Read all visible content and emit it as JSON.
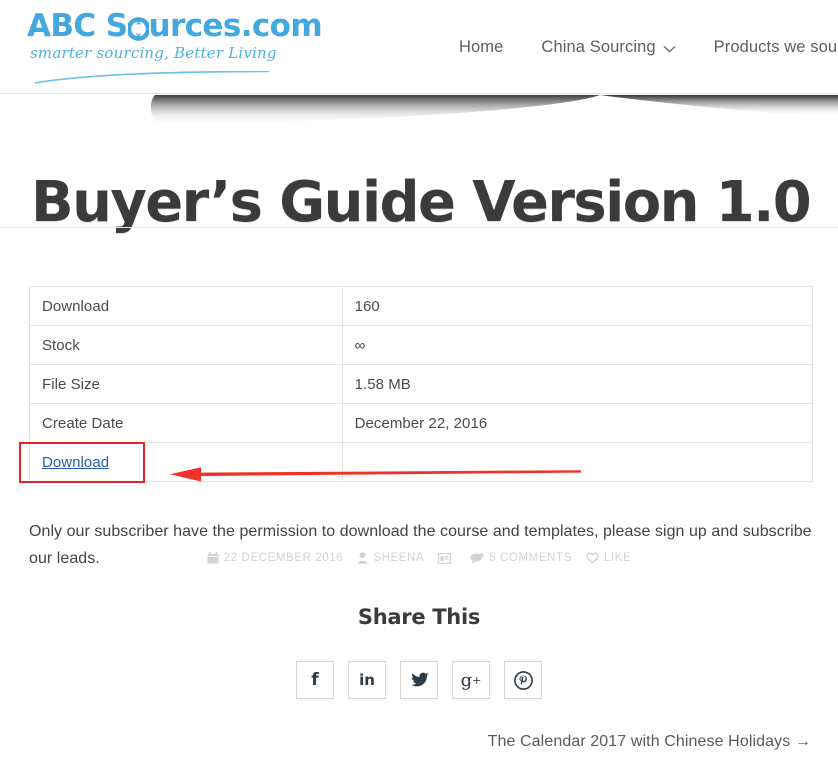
{
  "header": {
    "logo": {
      "wordmark_part1": "ABC S",
      "wordmark_icon": "link-chain-icon",
      "wordmark_part2": "urces.com",
      "tagline": "smarter sourcing, Better Living",
      "brand_color": "#43a8dd"
    },
    "nav": [
      {
        "label": "Home",
        "has_dropdown": false,
        "icon": null
      },
      {
        "label": "China Sourcing",
        "has_dropdown": true,
        "icon": "chevron-down-icon"
      },
      {
        "label": "Products we sourced",
        "has_dropdown": false,
        "icon": null
      }
    ]
  },
  "page": {
    "title": "Buyer’s Guide Version 1.0"
  },
  "details_table": {
    "rows": [
      {
        "label": "Download",
        "value": "160"
      },
      {
        "label": "Stock",
        "value": "∞"
      },
      {
        "label": "File Size",
        "value": "1.58 MB"
      },
      {
        "label": "Create Date",
        "value": "December 22, 2016"
      }
    ],
    "download_link_label": "Download",
    "download_link_color": "#2a5db0"
  },
  "annotation": {
    "box_color": "#e8202a",
    "arrow_color": "#ef3229",
    "arrow_direction": "left",
    "target": "download-link"
  },
  "body": {
    "paragraph": "Only our subscriber have the permission to download the course and templates, please sign up and subscribe our leads."
  },
  "post_meta": {
    "color": "#ccd4da",
    "items": [
      {
        "icon": "calendar-icon",
        "label": "22 DECEMBER 2016"
      },
      {
        "icon": "user-icon",
        "label": "SHEENA"
      },
      {
        "icon": "category-list-icon",
        "label": ""
      },
      {
        "icon": "comment-bubble-icon",
        "label": "5 COMMENTS"
      },
      {
        "icon": "heart-icon",
        "label": "LIKE"
      }
    ]
  },
  "share": {
    "heading": "Share This",
    "buttons": [
      {
        "icon": "facebook-icon",
        "glyph": "f"
      },
      {
        "icon": "linkedin-icon",
        "glyph": "in"
      },
      {
        "icon": "twitter-icon",
        "glyph": ""
      },
      {
        "icon": "google-plus-icon",
        "glyph": "g"
      },
      {
        "icon": "pinterest-icon",
        "glyph": ""
      }
    ]
  },
  "post_nav": {
    "next_label": "The Calendar 2017 with Chinese Holidays →"
  }
}
